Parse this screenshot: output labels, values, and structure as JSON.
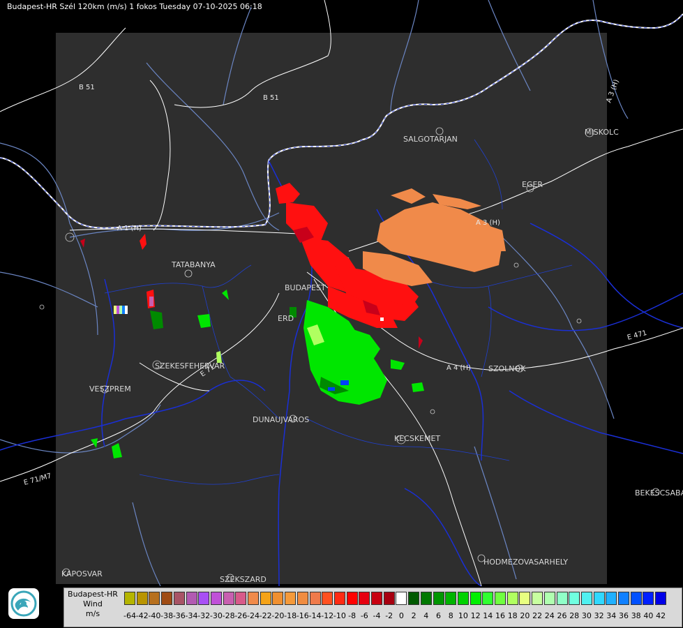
{
  "header": {
    "title": "Budapest-HR Szél 120km (m/s) 1 fokos Tuesday 07-10-2025 06:18"
  },
  "map": {
    "cities": [
      {
        "name": "SALGOTARJAN"
      },
      {
        "name": "EGER"
      },
      {
        "name": "MISKOLC"
      },
      {
        "name": "TATABANYA"
      },
      {
        "name": "BUDAPEST"
      },
      {
        "name": "ERD"
      },
      {
        "name": "SZEKESFEHERVAR"
      },
      {
        "name": "VESZPREM"
      },
      {
        "name": "DUNAUJVAROS"
      },
      {
        "name": "KECSKEMET"
      },
      {
        "name": "SZOLNOK"
      },
      {
        "name": "BEKESCSABA"
      },
      {
        "name": "HODMEZOVASARHELY"
      },
      {
        "name": "KAPOSVAR"
      },
      {
        "name": "SZEKSZARD"
      }
    ],
    "roads": [
      {
        "name": "B 51"
      },
      {
        "name": "B 51"
      },
      {
        "name": "A 1 (H)"
      },
      {
        "name": "A 3 (H)"
      },
      {
        "name": "A 3 (H)"
      },
      {
        "name": "A 4 (H)"
      },
      {
        "name": "E 71"
      },
      {
        "name": "E 71/M7"
      },
      {
        "name": "E 471"
      }
    ],
    "colors": {
      "background": "#000000",
      "radar_area": "#2e2e2e",
      "border": "#ffffff",
      "rivers": "#6b86c4",
      "admin": "#1a2fd6"
    }
  },
  "legend": {
    "title_line1": "Budapest-HR",
    "title_line2": "Wind",
    "title_line3": "m/s",
    "swatches": [
      {
        "value": "-64",
        "color": "#b5b500"
      },
      {
        "value": "-42",
        "color": "#b99400"
      },
      {
        "value": "-40",
        "color": "#b7701e"
      },
      {
        "value": "-38",
        "color": "#a04c14"
      },
      {
        "value": "-36",
        "color": "#a85466"
      },
      {
        "value": "-34",
        "color": "#b25ab2"
      },
      {
        "value": "-32",
        "color": "#a84ff5"
      },
      {
        "value": "-30",
        "color": "#c050d8"
      },
      {
        "value": "-28",
        "color": "#c860b0"
      },
      {
        "value": "-26",
        "color": "#d85a8a"
      },
      {
        "value": "-24",
        "color": "#f08a4a"
      },
      {
        "value": "-22",
        "color": "#f5a318"
      },
      {
        "value": "-20",
        "color": "#f09030"
      },
      {
        "value": "-18",
        "color": "#f59a3a"
      },
      {
        "value": "-16",
        "color": "#f08c40"
      },
      {
        "value": "-14",
        "color": "#ef7a4a"
      },
      {
        "value": "-12",
        "color": "#ff5020"
      },
      {
        "value": "-10",
        "color": "#ff2a12"
      },
      {
        "value": "-8",
        "color": "#ff0000"
      },
      {
        "value": "-6",
        "color": "#e60010"
      },
      {
        "value": "-4",
        "color": "#c80010"
      },
      {
        "value": "-2",
        "color": "#a80010"
      },
      {
        "value": "0",
        "color": "#ffffff"
      },
      {
        "value": "2",
        "color": "#005a00"
      },
      {
        "value": "4",
        "color": "#007800"
      },
      {
        "value": "6",
        "color": "#009600"
      },
      {
        "value": "8",
        "color": "#00b400"
      },
      {
        "value": "10",
        "color": "#00d200"
      },
      {
        "value": "12",
        "color": "#00f000"
      },
      {
        "value": "14",
        "color": "#30ff30"
      },
      {
        "value": "16",
        "color": "#70ff40"
      },
      {
        "value": "18",
        "color": "#b0ff60"
      },
      {
        "value": "20",
        "color": "#e8ff80"
      },
      {
        "value": "22",
        "color": "#c8ffa0"
      },
      {
        "value": "24",
        "color": "#b0ffb0"
      },
      {
        "value": "26",
        "color": "#90ffc8"
      },
      {
        "value": "28",
        "color": "#70ffe0"
      },
      {
        "value": "30",
        "color": "#50f0f0"
      },
      {
        "value": "32",
        "color": "#30d8ff"
      },
      {
        "value": "34",
        "color": "#20b0ff"
      },
      {
        "value": "36",
        "color": "#1080ff"
      },
      {
        "value": "38",
        "color": "#0050ff"
      },
      {
        "value": "40",
        "color": "#0020ff"
      },
      {
        "value": "42",
        "color": "#0000e8"
      }
    ]
  },
  "logo": {
    "icon": "met-service-logo-icon"
  }
}
